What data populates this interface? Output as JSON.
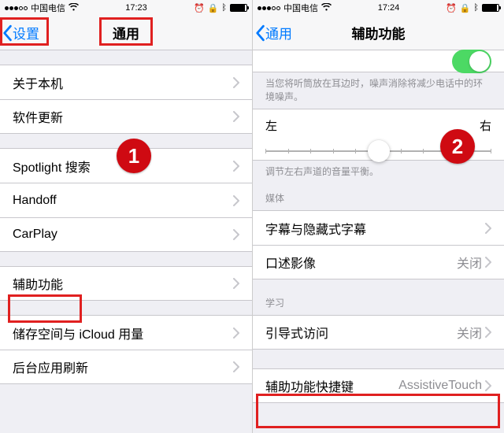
{
  "status": {
    "carrier": "中国电信",
    "signal_filled": 3,
    "time_left": "17:23",
    "time_right": "17:24"
  },
  "left": {
    "back": "设置",
    "title": "通用",
    "group1": [
      {
        "label": "关于本机"
      },
      {
        "label": "软件更新"
      }
    ],
    "group2": [
      {
        "label": "Spotlight 搜索"
      },
      {
        "label": "Handoff"
      },
      {
        "label": "CarPlay"
      }
    ],
    "group3": [
      {
        "label": "辅助功能"
      }
    ],
    "group4": [
      {
        "label": "储存空间与 iCloud 用量"
      },
      {
        "label": "后台应用刷新"
      }
    ],
    "badge": "1"
  },
  "right": {
    "back": "通用",
    "title": "辅助功能",
    "partial_note_line": "当您将听筒放在耳边时，噪声消除将减少电话中的环境噪声。",
    "balance": {
      "left": "左",
      "right": "右",
      "footer": "调节左右声道的音量平衡。"
    },
    "media_header": "媒体",
    "media_items": [
      {
        "label": "字幕与隐藏式字幕",
        "value": ""
      },
      {
        "label": "口述影像",
        "value": "关闭"
      }
    ],
    "learn_header": "学习",
    "learn_items": [
      {
        "label": "引导式访问",
        "value": "关闭"
      }
    ],
    "shortcut": {
      "label": "辅助功能快捷键",
      "value": "AssistiveTouch"
    },
    "badge": "2"
  }
}
